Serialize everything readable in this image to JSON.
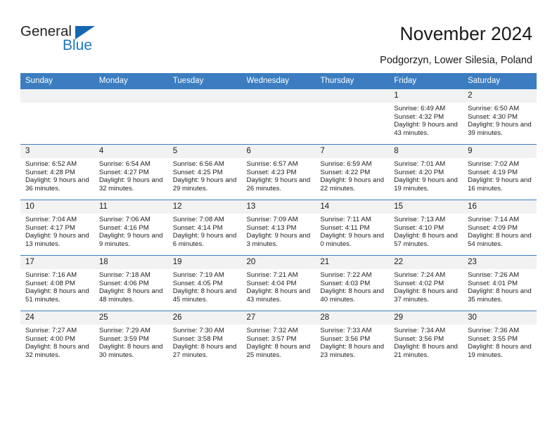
{
  "brand": {
    "name_part1": "General",
    "name_part2": "Blue",
    "triangle_color": "#1567b2",
    "blue_color": "#1b76c4"
  },
  "header": {
    "title": "November 2024",
    "subtitle": "Podgorzyn, Lower Silesia, Poland"
  },
  "theme": {
    "header_blue": "#3b7dc0",
    "daynum_bg": "#f2f2f2",
    "border_blue": "#3b7dc0"
  },
  "weekdays": [
    "Sunday",
    "Monday",
    "Tuesday",
    "Wednesday",
    "Thursday",
    "Friday",
    "Saturday"
  ],
  "weeks": [
    [
      {
        "day": "",
        "empty": true
      },
      {
        "day": "",
        "empty": true
      },
      {
        "day": "",
        "empty": true
      },
      {
        "day": "",
        "empty": true
      },
      {
        "day": "",
        "empty": true
      },
      {
        "day": "1",
        "sunrise": "Sunrise: 6:49 AM",
        "sunset": "Sunset: 4:32 PM",
        "daylight": "Daylight: 9 hours and 43 minutes."
      },
      {
        "day": "2",
        "sunrise": "Sunrise: 6:50 AM",
        "sunset": "Sunset: 4:30 PM",
        "daylight": "Daylight: 9 hours and 39 minutes."
      }
    ],
    [
      {
        "day": "3",
        "sunrise": "Sunrise: 6:52 AM",
        "sunset": "Sunset: 4:28 PM",
        "daylight": "Daylight: 9 hours and 36 minutes."
      },
      {
        "day": "4",
        "sunrise": "Sunrise: 6:54 AM",
        "sunset": "Sunset: 4:27 PM",
        "daylight": "Daylight: 9 hours and 32 minutes."
      },
      {
        "day": "5",
        "sunrise": "Sunrise: 6:56 AM",
        "sunset": "Sunset: 4:25 PM",
        "daylight": "Daylight: 9 hours and 29 minutes."
      },
      {
        "day": "6",
        "sunrise": "Sunrise: 6:57 AM",
        "sunset": "Sunset: 4:23 PM",
        "daylight": "Daylight: 9 hours and 26 minutes."
      },
      {
        "day": "7",
        "sunrise": "Sunrise: 6:59 AM",
        "sunset": "Sunset: 4:22 PM",
        "daylight": "Daylight: 9 hours and 22 minutes."
      },
      {
        "day": "8",
        "sunrise": "Sunrise: 7:01 AM",
        "sunset": "Sunset: 4:20 PM",
        "daylight": "Daylight: 9 hours and 19 minutes."
      },
      {
        "day": "9",
        "sunrise": "Sunrise: 7:02 AM",
        "sunset": "Sunset: 4:19 PM",
        "daylight": "Daylight: 9 hours and 16 minutes."
      }
    ],
    [
      {
        "day": "10",
        "sunrise": "Sunrise: 7:04 AM",
        "sunset": "Sunset: 4:17 PM",
        "daylight": "Daylight: 9 hours and 13 minutes."
      },
      {
        "day": "11",
        "sunrise": "Sunrise: 7:06 AM",
        "sunset": "Sunset: 4:16 PM",
        "daylight": "Daylight: 9 hours and 9 minutes."
      },
      {
        "day": "12",
        "sunrise": "Sunrise: 7:08 AM",
        "sunset": "Sunset: 4:14 PM",
        "daylight": "Daylight: 9 hours and 6 minutes."
      },
      {
        "day": "13",
        "sunrise": "Sunrise: 7:09 AM",
        "sunset": "Sunset: 4:13 PM",
        "daylight": "Daylight: 9 hours and 3 minutes."
      },
      {
        "day": "14",
        "sunrise": "Sunrise: 7:11 AM",
        "sunset": "Sunset: 4:11 PM",
        "daylight": "Daylight: 9 hours and 0 minutes."
      },
      {
        "day": "15",
        "sunrise": "Sunrise: 7:13 AM",
        "sunset": "Sunset: 4:10 PM",
        "daylight": "Daylight: 8 hours and 57 minutes."
      },
      {
        "day": "16",
        "sunrise": "Sunrise: 7:14 AM",
        "sunset": "Sunset: 4:09 PM",
        "daylight": "Daylight: 8 hours and 54 minutes."
      }
    ],
    [
      {
        "day": "17",
        "sunrise": "Sunrise: 7:16 AM",
        "sunset": "Sunset: 4:08 PM",
        "daylight": "Daylight: 8 hours and 51 minutes."
      },
      {
        "day": "18",
        "sunrise": "Sunrise: 7:18 AM",
        "sunset": "Sunset: 4:06 PM",
        "daylight": "Daylight: 8 hours and 48 minutes."
      },
      {
        "day": "19",
        "sunrise": "Sunrise: 7:19 AM",
        "sunset": "Sunset: 4:05 PM",
        "daylight": "Daylight: 8 hours and 45 minutes."
      },
      {
        "day": "20",
        "sunrise": "Sunrise: 7:21 AM",
        "sunset": "Sunset: 4:04 PM",
        "daylight": "Daylight: 8 hours and 43 minutes."
      },
      {
        "day": "21",
        "sunrise": "Sunrise: 7:22 AM",
        "sunset": "Sunset: 4:03 PM",
        "daylight": "Daylight: 8 hours and 40 minutes."
      },
      {
        "day": "22",
        "sunrise": "Sunrise: 7:24 AM",
        "sunset": "Sunset: 4:02 PM",
        "daylight": "Daylight: 8 hours and 37 minutes."
      },
      {
        "day": "23",
        "sunrise": "Sunrise: 7:26 AM",
        "sunset": "Sunset: 4:01 PM",
        "daylight": "Daylight: 8 hours and 35 minutes."
      }
    ],
    [
      {
        "day": "24",
        "sunrise": "Sunrise: 7:27 AM",
        "sunset": "Sunset: 4:00 PM",
        "daylight": "Daylight: 8 hours and 32 minutes."
      },
      {
        "day": "25",
        "sunrise": "Sunrise: 7:29 AM",
        "sunset": "Sunset: 3:59 PM",
        "daylight": "Daylight: 8 hours and 30 minutes."
      },
      {
        "day": "26",
        "sunrise": "Sunrise: 7:30 AM",
        "sunset": "Sunset: 3:58 PM",
        "daylight": "Daylight: 8 hours and 27 minutes."
      },
      {
        "day": "27",
        "sunrise": "Sunrise: 7:32 AM",
        "sunset": "Sunset: 3:57 PM",
        "daylight": "Daylight: 8 hours and 25 minutes."
      },
      {
        "day": "28",
        "sunrise": "Sunrise: 7:33 AM",
        "sunset": "Sunset: 3:56 PM",
        "daylight": "Daylight: 8 hours and 23 minutes."
      },
      {
        "day": "29",
        "sunrise": "Sunrise: 7:34 AM",
        "sunset": "Sunset: 3:56 PM",
        "daylight": "Daylight: 8 hours and 21 minutes."
      },
      {
        "day": "30",
        "sunrise": "Sunrise: 7:36 AM",
        "sunset": "Sunset: 3:55 PM",
        "daylight": "Daylight: 8 hours and 19 minutes."
      }
    ]
  ]
}
